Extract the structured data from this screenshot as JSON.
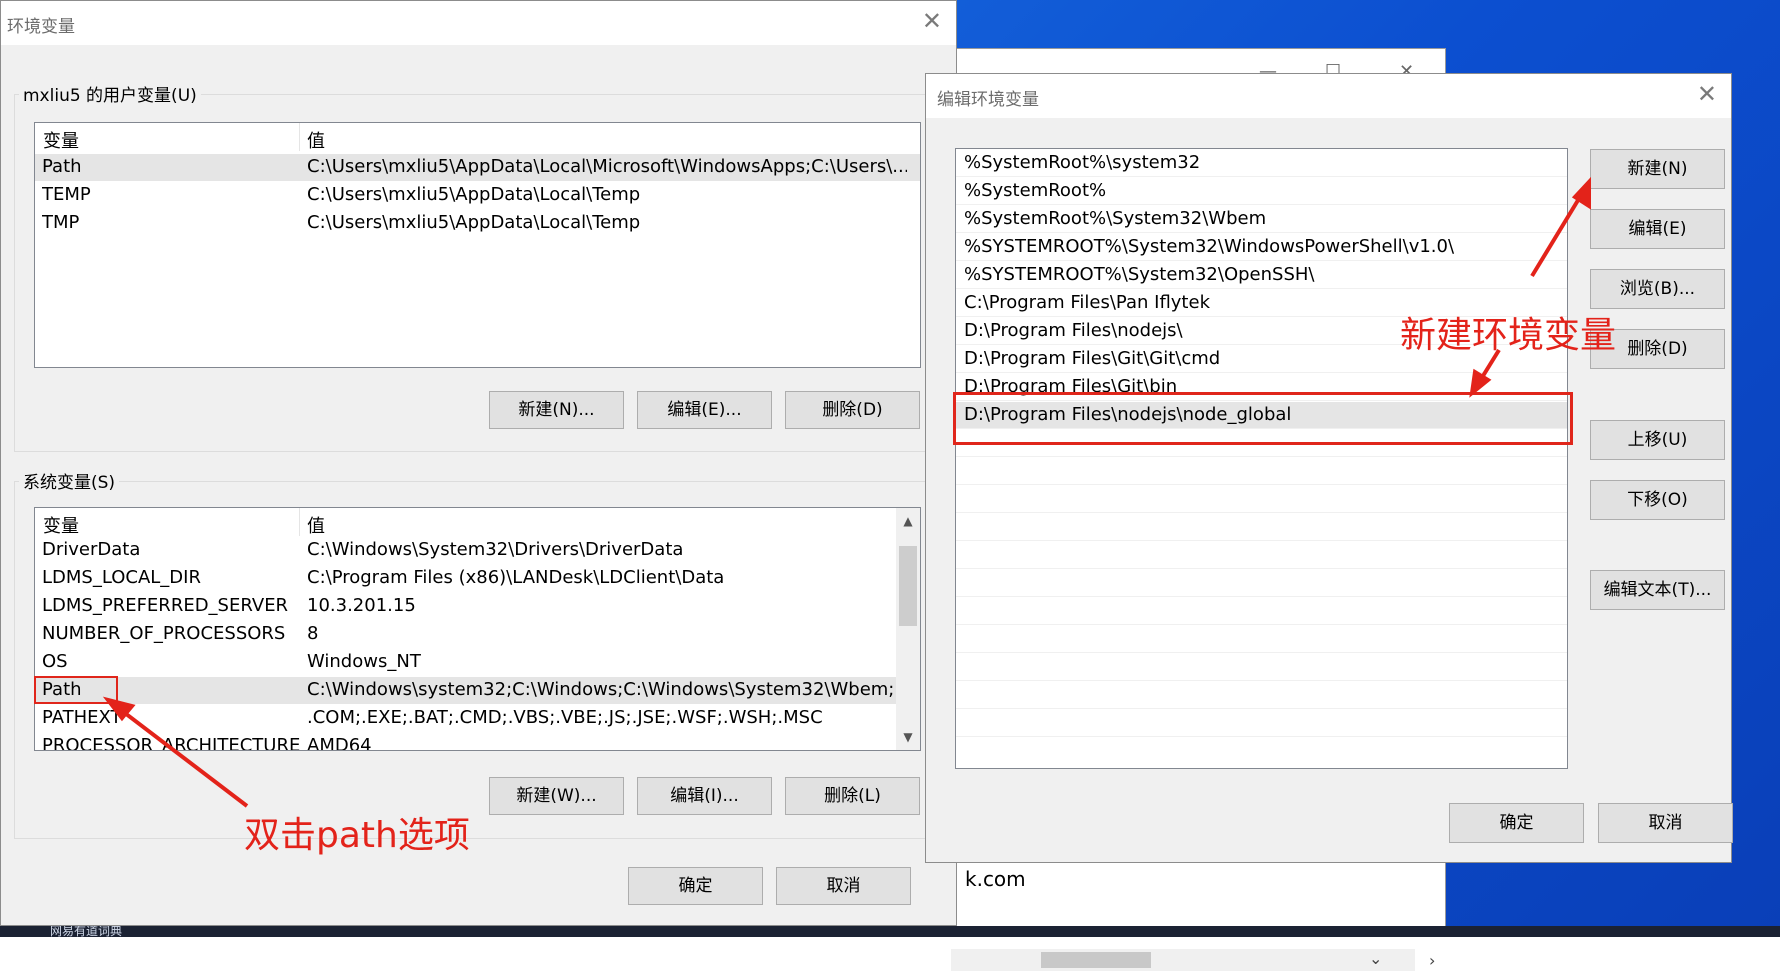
{
  "taskbar": {
    "label": "网易有道词典"
  },
  "background_window": {
    "visible_text": "k.com",
    "minimize": "—",
    "maximize": "☐",
    "close": "✕"
  },
  "env_dialog": {
    "title": "环境变量",
    "close_glyph": "✕",
    "user_group": {
      "label": "mxliu5 的用户变量(U)",
      "columns": [
        "变量",
        "值"
      ],
      "rows": [
        {
          "name": "Path",
          "value": "C:\\Users\\mxliu5\\AppData\\Local\\Microsoft\\WindowsApps;C:\\Users\\..."
        },
        {
          "name": "TEMP",
          "value": "C:\\Users\\mxliu5\\AppData\\Local\\Temp"
        },
        {
          "name": "TMP",
          "value": "C:\\Users\\mxliu5\\AppData\\Local\\Temp"
        }
      ],
      "buttons": {
        "new": "新建(N)...",
        "edit": "编辑(E)...",
        "delete": "删除(D)"
      }
    },
    "system_group": {
      "label": "系统变量(S)",
      "columns": [
        "变量",
        "值"
      ],
      "rows": [
        {
          "name": "DriverData",
          "value": "C:\\Windows\\System32\\Drivers\\DriverData"
        },
        {
          "name": "LDMS_LOCAL_DIR",
          "value": "C:\\Program Files (x86)\\LANDesk\\LDClient\\Data"
        },
        {
          "name": "LDMS_PREFERRED_SERVER",
          "value": "10.3.201.15"
        },
        {
          "name": "NUMBER_OF_PROCESSORS",
          "value": "8"
        },
        {
          "name": "OS",
          "value": "Windows_NT"
        },
        {
          "name": "Path",
          "value": "C:\\Windows\\system32;C:\\Windows;C:\\Windows\\System32\\Wbem;..."
        },
        {
          "name": "PATHEXT",
          "value": ".COM;.EXE;.BAT;.CMD;.VBS;.VBE;.JS;.JSE;.WSF;.WSH;.MSC"
        },
        {
          "name": "PROCESSOR_ARCHITECTURE",
          "value": "AMD64"
        }
      ],
      "buttons": {
        "new": "新建(W)...",
        "edit": "编辑(I)...",
        "delete": "删除(L)"
      }
    },
    "ok": "确定",
    "cancel": "取消",
    "scroll_up": "▲",
    "scroll_down": "▼"
  },
  "edit_dialog": {
    "title": "编辑环境变量",
    "close_glyph": "✕",
    "entries": [
      "%SystemRoot%\\system32",
      "%SystemRoot%",
      "%SystemRoot%\\System32\\Wbem",
      "%SYSTEMROOT%\\System32\\WindowsPowerShell\\v1.0\\",
      "%SYSTEMROOT%\\System32\\OpenSSH\\",
      "C:\\Program Files\\Pan Iflytek",
      "D:\\Program Files\\nodejs\\",
      "D:\\Program Files\\Git\\Git\\cmd",
      "D:\\Program Files\\Git\\bin",
      "D:\\Program Files\\nodejs\\node_global"
    ],
    "selected_index": 9,
    "buttons": {
      "new": "新建(N)",
      "edit": "编辑(E)",
      "browse": "浏览(B)...",
      "delete": "删除(D)",
      "up": "上移(U)",
      "down": "下移(O)",
      "edit_text": "编辑文本(T)..."
    },
    "ok": "确定",
    "cancel": "取消"
  },
  "annotations": {
    "double_click_path": "双击path选项",
    "new_env_var": "新建环境变量",
    "color": "#e3231a"
  }
}
